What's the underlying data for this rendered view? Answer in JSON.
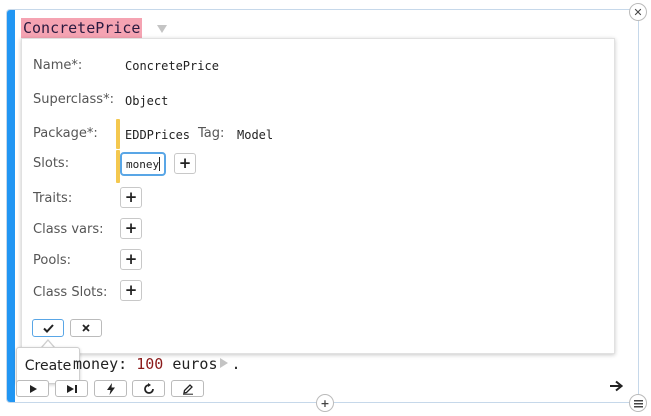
{
  "class_name": "ConcretePrice",
  "form": {
    "name_label": "Name*:",
    "name_value": "ConcretePrice",
    "superclass_label": "Superclass*:",
    "superclass_value": "Object",
    "package_label": "Package*:",
    "package_value": "EDDPrices",
    "tag_label": "Tag:",
    "tag_value": "Model",
    "slots_label": "Slots:",
    "slot_input_value": "money",
    "traits_label": "Traits:",
    "class_vars_label": "Class vars:",
    "pools_label": "Pools:",
    "class_slots_label": "Class Slots:"
  },
  "tooltip": "Create",
  "code": {
    "keyword": "money:",
    "number": "100",
    "unit": "euros",
    "period": "."
  },
  "icons": {
    "close": "close-icon",
    "plus": "plus-icon",
    "accept": "check-icon",
    "cancel": "x-icon",
    "play": "play-icon",
    "step": "play-step-icon",
    "lightning": "lightning-icon",
    "refresh": "refresh-icon",
    "edit": "pencil-icon",
    "arrow": "arrow-right-icon",
    "menu": "menu-icon"
  },
  "colors": {
    "accent": "#2196f3",
    "class_name_bg": "#f5a3b2",
    "warning_bar": "#f4c84f",
    "focus_border": "#59a6e6",
    "number": "#8b1a1a"
  }
}
